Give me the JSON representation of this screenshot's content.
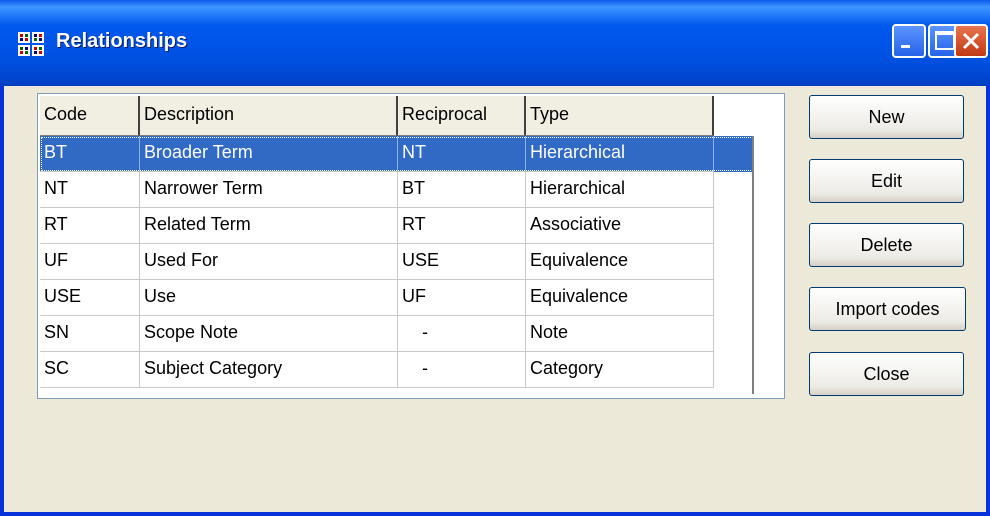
{
  "window": {
    "title": "Relationships"
  },
  "table": {
    "headers": [
      "Code",
      "Description",
      "Reciprocal",
      "Type"
    ],
    "rows": [
      [
        "BT",
        "Broader Term",
        "NT",
        "Hierarchical"
      ],
      [
        "NT",
        "Narrower Term",
        "BT",
        "Hierarchical"
      ],
      [
        "RT",
        "Related Term",
        "RT",
        "Associative"
      ],
      [
        "UF",
        "Used For",
        "USE",
        "Equivalence"
      ],
      [
        "USE",
        "Use",
        "UF",
        "Equivalence"
      ],
      [
        "SN",
        "Scope Note",
        "-",
        "Note"
      ],
      [
        "SC",
        "Subject Category",
        "-",
        "Category"
      ]
    ],
    "selected_row": "BT"
  },
  "buttons": {
    "new": "New",
    "edit": "Edit",
    "delete": "Delete",
    "import_codes": "Import codes",
    "close": "Close"
  },
  "colors": {
    "titlebar": "#0058ee",
    "selection": "#316ac5",
    "background": "#ece9d8"
  }
}
